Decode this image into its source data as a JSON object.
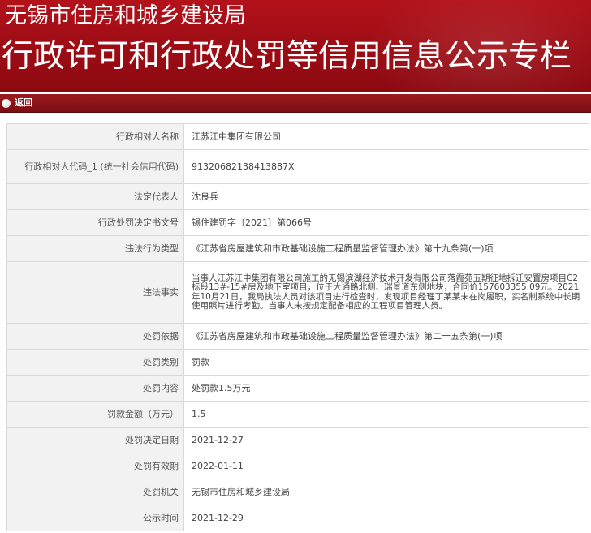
{
  "header": {
    "org_name": "无锡市住房和城乡建设局",
    "column_title": "行政许可和行政处罚等信用信息公示专栏"
  },
  "nav": {
    "back_label": "返回"
  },
  "record": {
    "rows": [
      {
        "label": "行政相对人名称",
        "value": "江苏江中集团有限公司"
      },
      {
        "label": "行政相对人代码_1 (统一社会信用代码)",
        "value": "91320682138413887X"
      },
      {
        "label": "法定代表人",
        "value": "沈良兵"
      },
      {
        "label": "行政处罚决定书文号",
        "value": "锡住建罚字〔2021〕第066号"
      },
      {
        "label": "违法行为类型",
        "value": "《江苏省房屋建筑和市政基础设施工程质量监督管理办法》第十九条第(一)项"
      },
      {
        "label": "违法事实",
        "value": "当事人江苏江中集团有限公司施工的无锡滨湖经济技术开发有限公司落霞苑五期征地拆迁安置房项目C2标段13#-15#房及地下室项目，位于大通路北侧、瑞景道东侧地块，合同价157603355.09元。2021年10月21日，我局执法人员对该项目进行检查时，发现项目经理丁某某未在岗履职，实名制系统中长期使用照片进行考勤。当事人未按规定配备相应的工程项目管理人员。"
      },
      {
        "label": "处罚依据",
        "value": "《江苏省房屋建筑和市政基础设施工程质量监督管理办法》第二十五条第(一)项"
      },
      {
        "label": "处罚类别",
        "value": "罚款"
      },
      {
        "label": "处罚内容",
        "value": "处罚款1.5万元"
      },
      {
        "label": "罚款金额（万元）",
        "value": "1.5"
      },
      {
        "label": "处罚决定日期",
        "value": "2021-12-27"
      },
      {
        "label": "处罚有效期",
        "value": "2022-01-11"
      },
      {
        "label": "处罚机关",
        "value": "无锡市住房和城乡建设局"
      },
      {
        "label": "公示时间",
        "value": "2021-12-29"
      }
    ]
  }
}
